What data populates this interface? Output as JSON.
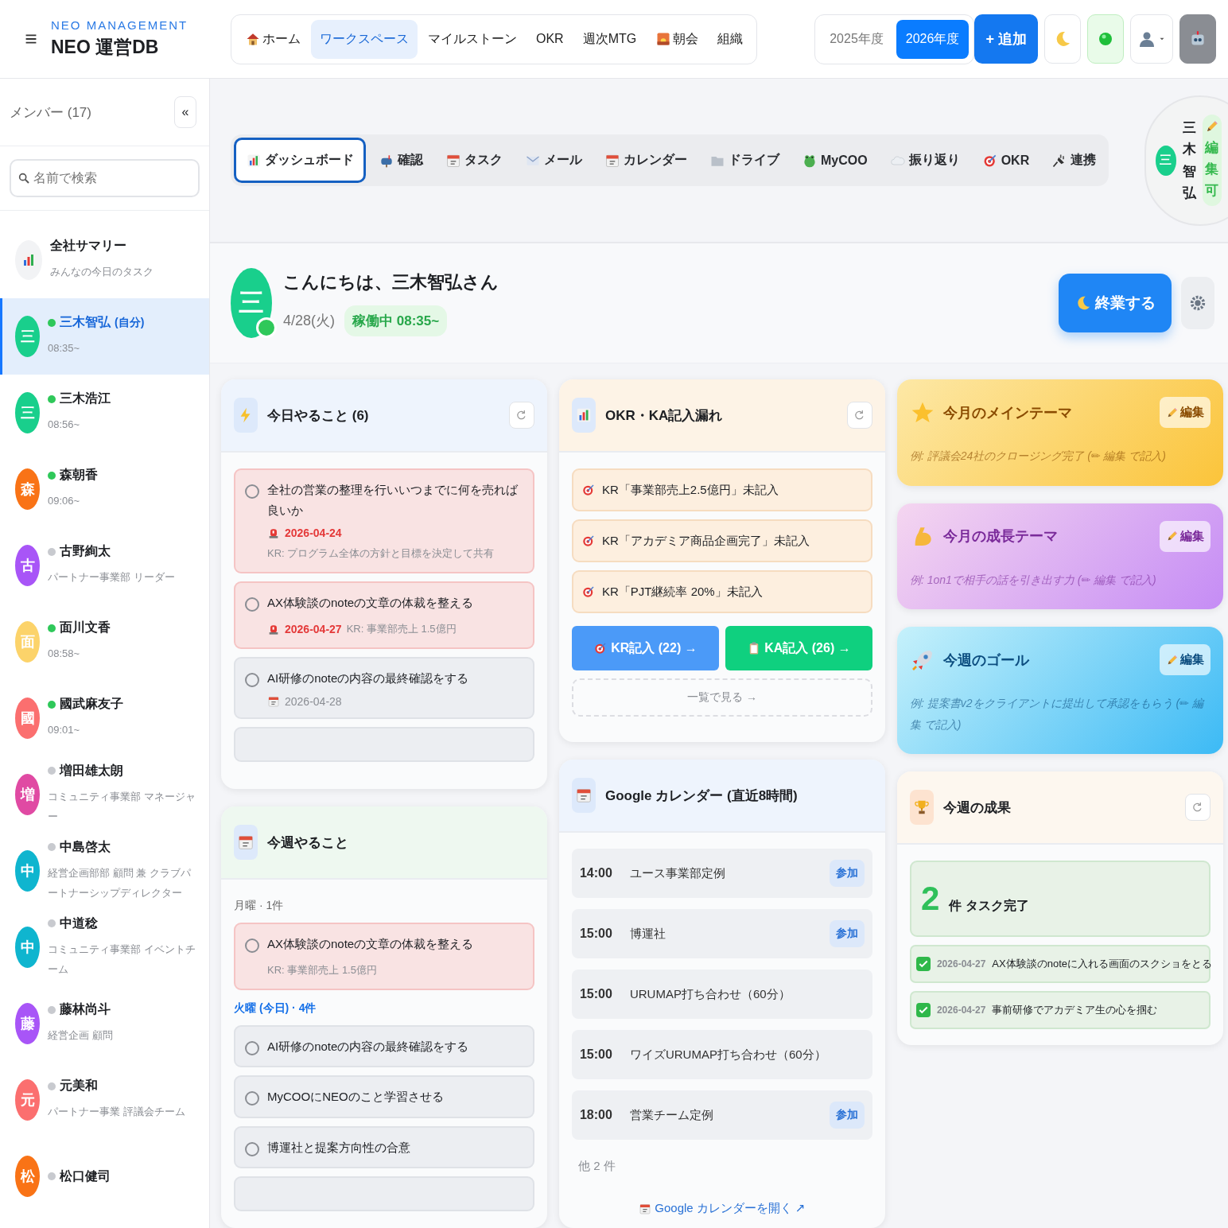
{
  "header": {
    "brand_sub": "NEO MANAGEMENT",
    "brand": "NEO 運営DB",
    "nav": [
      {
        "label": "ホーム",
        "selected": false
      },
      {
        "label": "ワークスペース",
        "selected": true
      },
      {
        "label": "マイルストーン",
        "selected": false
      },
      {
        "label": "OKR",
        "selected": false
      },
      {
        "label": "週次MTG",
        "selected": false
      },
      {
        "label": "朝会",
        "selected": false
      },
      {
        "label": "組織",
        "selected": false
      }
    ],
    "years": [
      {
        "label": "2025年度",
        "selected": false
      },
      {
        "label": "2026年度",
        "selected": true
      }
    ],
    "add_button": "+ 追加"
  },
  "sidebar": {
    "title": "メンバー (17)",
    "collapse": "«",
    "search": {
      "placeholder": "名前で検索"
    },
    "summary": {
      "name": "全社サマリー",
      "sub": "みんなの今日のタスク",
      "selected": false
    },
    "members": [
      {
        "initial": "三",
        "name": "三木智弘",
        "tag": "(自分)",
        "sub": "08:35~",
        "online": true,
        "selected": true,
        "color": "#19cf8c"
      },
      {
        "initial": "三",
        "name": "三木浩江",
        "sub": "08:56~",
        "online": true,
        "selected": false,
        "color": "#19cf8c"
      },
      {
        "initial": "森",
        "name": "森朝香",
        "sub": "09:06~",
        "online": true,
        "selected": false,
        "color": "#f97316"
      },
      {
        "initial": "古",
        "name": "古野絢太",
        "sub": "パートナー事業部 リーダー",
        "online": false,
        "selected": false,
        "color": "#a855f7"
      },
      {
        "initial": "面",
        "name": "面川文香",
        "sub": "08:58~",
        "online": true,
        "selected": false,
        "color": "#fcd36a"
      },
      {
        "initial": "國",
        "name": "國武麻友子",
        "sub": "09:01~",
        "online": true,
        "selected": false,
        "color": "#fb6f6f"
      },
      {
        "initial": "増",
        "name": "増田雄太朗",
        "sub": "コミュニティ事業部 マネージャー",
        "online": false,
        "selected": false,
        "color": "#e04aa3"
      },
      {
        "initial": "中",
        "name": "中島啓太",
        "sub": "経営企画部部 顧問 兼 クラブパートナーシップディレクター",
        "online": false,
        "selected": false,
        "color": "#0fb5cf"
      },
      {
        "initial": "中",
        "name": "中道稔",
        "sub": "コミュニティ事業部 イベントチーム",
        "online": false,
        "selected": false,
        "color": "#0fb5cf"
      },
      {
        "initial": "藤",
        "name": "藤林尚斗",
        "sub": "経営企画 顧問",
        "online": false,
        "selected": false,
        "color": "#a855f7"
      },
      {
        "initial": "元",
        "name": "元美和",
        "sub": "パートナー事業 評議会チーム",
        "online": false,
        "selected": false,
        "color": "#fb6f6f"
      },
      {
        "initial": "松",
        "name": "松口健司",
        "online": false,
        "selected": false,
        "color": "#f97316"
      }
    ]
  },
  "tabs": [
    {
      "label": "ダッシュボード",
      "selected": true
    },
    {
      "label": "確認",
      "selected": false
    },
    {
      "label": "タスク",
      "selected": false
    },
    {
      "label": "メール",
      "selected": false
    },
    {
      "label": "カレンダー",
      "selected": false
    },
    {
      "label": "ドライブ",
      "selected": false
    },
    {
      "label": "MyCOO",
      "selected": false
    },
    {
      "label": "振り返り",
      "selected": false
    },
    {
      "label": "OKR",
      "selected": false
    },
    {
      "label": "連携",
      "selected": false
    }
  ],
  "profile": {
    "initial": "三",
    "name": "三木智弘",
    "badge": "編集可"
  },
  "greeting": {
    "initial": "三",
    "online": true,
    "title": "こんにちは、三木智弘さん",
    "date": "4/28(火)",
    "status": "稼働中 08:35~",
    "end_button": "終業する"
  },
  "today": {
    "title": "今日やること (6)",
    "tasks": [
      {
        "title": "全社の営業の整理を行いいつまでに何を売れば良いか",
        "due": "2026-04-24",
        "overdue": true,
        "kr": "KR: プログラム全体の方針と目標を決定して共有",
        "done": false
      },
      {
        "title": "AX体験談のnoteの文章の体裁を整える",
        "due": "2026-04-27",
        "overdue": true,
        "kr": "KR: 事業部売上 1.5億円",
        "done": false
      },
      {
        "title": "AI研修のnoteの内容の最終確認をする",
        "due": "2026-04-28",
        "overdue": false,
        "done": false
      }
    ]
  },
  "week": {
    "title": "今週やること",
    "groups": [
      {
        "label": "月曜 · 1件",
        "today": false,
        "tasks": [
          {
            "title": "AX体験談のnoteの文章の体裁を整える",
            "kr": "KR: 事業部売上 1.5億円",
            "overdue": true,
            "done": false
          }
        ]
      },
      {
        "label": "火曜 (今日) · 4件",
        "today": true,
        "tasks": [
          {
            "title": "AI研修のnoteの内容の最終確認をする",
            "overdue": false,
            "done": false
          },
          {
            "title": "MyCOOにNEOのこと学習させる",
            "overdue": false,
            "done": false
          },
          {
            "title": "博運社と提案方向性の合意",
            "overdue": false,
            "done": false
          }
        ]
      }
    ]
  },
  "okr": {
    "title": "OKR・KA記入漏れ",
    "items": [
      "KR「事業部売上2.5億円」未記入",
      "KR「アカデミア商品企画完了」未記入",
      "KR「PJT継続率 20%」未記入"
    ],
    "buttons": [
      {
        "label": "KR記入 (22) →",
        "kind": "kr"
      },
      {
        "label": "KA記入 (26) →",
        "kind": "ka"
      }
    ],
    "link": "一覧で見る →"
  },
  "calendar": {
    "title": "Google カレンダー (直近8時間)",
    "events": [
      {
        "time": "14:00",
        "title": "ユース事業部定例",
        "join": "参加"
      },
      {
        "time": "15:00",
        "title": "博運社",
        "join": "参加"
      },
      {
        "time": "15:00",
        "title": "URUMAP打ち合わせ（60分）"
      },
      {
        "time": "15:00",
        "title": "ワイズURUMAP打ち合わせ（60分）"
      },
      {
        "time": "18:00",
        "title": "営業チーム定例",
        "join": "参加"
      }
    ],
    "more": "他 2 件",
    "link": "Google カレンダーを開く ↗"
  },
  "themes": [
    {
      "kind": "main",
      "title": "今月のメインテーマ",
      "edit": "編集",
      "example": "例: 評議会24社のクロージング完了 (✏ 編集 で記入)"
    },
    {
      "kind": "growth",
      "title": "今月の成長テーマ",
      "edit": "編集",
      "example": "例: 1on1で相手の話を引き出す力 (✏ 編集 で記入)"
    },
    {
      "kind": "goal",
      "title": "今週のゴール",
      "edit": "編集",
      "example": "例: 提案書v2をクライアントに提出して承認をもらう (✏ 編集 で記入)"
    }
  ],
  "results": {
    "title": "今週の成果",
    "count": "2",
    "count_label": "件 タスク完了",
    "items": [
      {
        "date": "2026-04-27",
        "title": "AX体験談のnoteに入れる画面のスクショをとる",
        "done": true
      },
      {
        "date": "2026-04-27",
        "title": "事前研修でアカデミア生の心を掴む",
        "done": true
      }
    ]
  }
}
